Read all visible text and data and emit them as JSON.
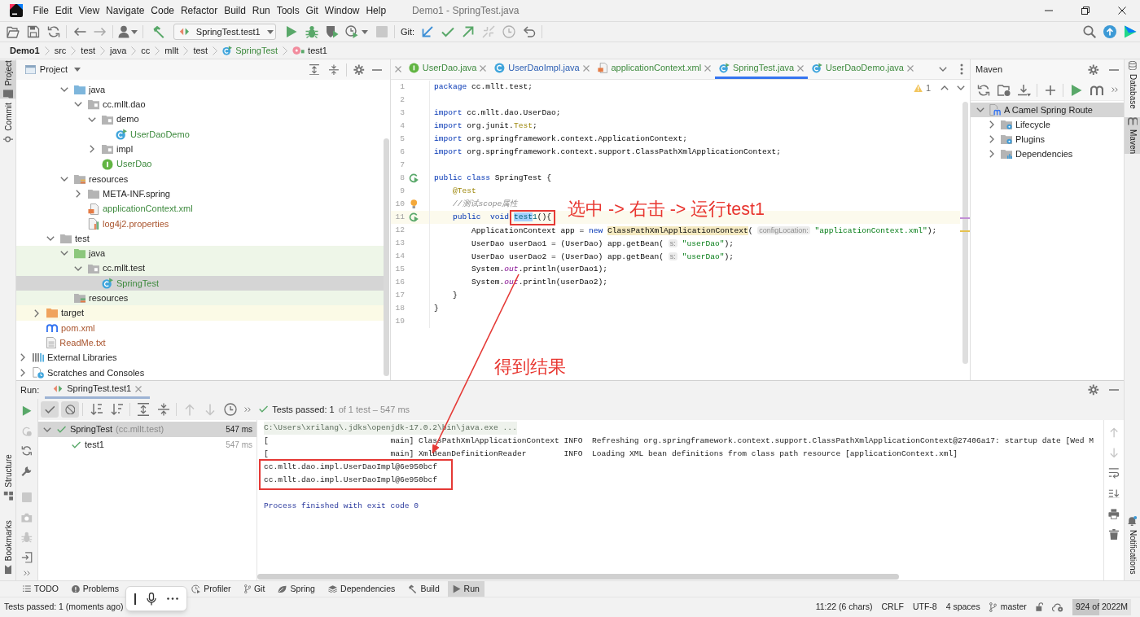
{
  "window": {
    "title": "Demo1 - SpringTest.java"
  },
  "menu": [
    "File",
    "Edit",
    "View",
    "Navigate",
    "Code",
    "Refactor",
    "Build",
    "Run",
    "Tools",
    "Git",
    "Window",
    "Help"
  ],
  "toolbar": {
    "run_configuration": "SpringTest.test1",
    "vcs_label": "Git:"
  },
  "breadcrumbs": [
    {
      "label": "Demo1",
      "kind": "project"
    },
    {
      "label": "src",
      "kind": "folder"
    },
    {
      "label": "test",
      "kind": "folder"
    },
    {
      "label": "java",
      "kind": "folder"
    },
    {
      "label": "cc",
      "kind": "folder"
    },
    {
      "label": "mllt",
      "kind": "folder"
    },
    {
      "label": "test",
      "kind": "folder"
    },
    {
      "label": "SpringTest",
      "kind": "class",
      "color": "#3e8a3e"
    },
    {
      "label": "test1",
      "kind": "method"
    }
  ],
  "left_tool_windows": [
    {
      "label": "Project",
      "kind": "project",
      "selected": true
    },
    {
      "label": "Commit",
      "kind": "commit",
      "selected": false
    }
  ],
  "left_tool_windows_bottom": [
    {
      "label": "Structure",
      "kind": "structure",
      "selected": false
    },
    {
      "label": "Bookmarks",
      "kind": "bookmarks",
      "selected": false
    }
  ],
  "right_tool_windows": [
    {
      "label": "Database",
      "kind": "database",
      "selected": false
    },
    {
      "label": "Maven",
      "kind": "maven",
      "selected": true
    }
  ],
  "right_tool_windows_bottom": [
    {
      "label": "Notifications",
      "kind": "notifications",
      "selected": false
    }
  ],
  "project": {
    "title": "Project",
    "tree": [
      {
        "children": [
          {
            "children": [
              {
                "children": [
                  {
                    "label": "java",
                    "kind": "source-root",
                    "expanded": true,
                    "selected": false,
                    "children": [
                      {
                        "label": "cc.mllt.dao",
                        "kind": "package",
                        "expanded": true,
                        "selected": false,
                        "children": [
                          {
                            "label": "demo",
                            "kind": "package",
                            "expanded": true,
                            "selected": false,
                            "children": [
                              {
                                "label": "UserDaoDemo",
                                "kind": "runnable-class",
                                "selected": false,
                                "color": "#3e8a3e"
                              }
                            ]
                          },
                          {
                            "label": "impl",
                            "kind": "package",
                            "expanded": false,
                            "selected": false
                          },
                          {
                            "label": "UserDao",
                            "kind": "interface",
                            "selected": false,
                            "color": "#3e8a3e"
                          }
                        ]
                      }
                    ]
                  },
                  {
                    "label": "resources",
                    "kind": "resources-root",
                    "expanded": true,
                    "selected": false,
                    "children": [
                      {
                        "label": "META-INF.spring",
                        "kind": "folder",
                        "expanded": false,
                        "selected": false
                      },
                      {
                        "label": "applicationContext.xml",
                        "kind": "xml-file",
                        "selected": false,
                        "color": "#3e8a3e"
                      },
                      {
                        "label": "log4j2.properties",
                        "kind": "properties-file",
                        "selected": false,
                        "color": "#a9542d"
                      }
                    ]
                  }
                ]
              },
              {
                "label": "test",
                "kind": "folder",
                "expanded": true,
                "selected": false,
                "children": [
                  {
                    "label": "java",
                    "kind": "test-root",
                    "expanded": true,
                    "selected": false,
                    "test_sources": true,
                    "children": [
                      {
                        "label": "cc.mllt.test",
                        "kind": "package",
                        "expanded": true,
                        "selected": false,
                        "test_sources": true,
                        "children": [
                          {
                            "label": "SpringTest",
                            "kind": "runnable-class",
                            "selected": true,
                            "color": "#3e8a3e"
                          }
                        ]
                      }
                    ]
                  },
                  {
                    "label": "resources",
                    "kind": "test-resources-root",
                    "selected": false,
                    "test_sources": true
                  }
                ]
              }
            ]
          },
          {
            "label": "target",
            "kind": "excluded-folder",
            "expanded": false,
            "selected": false,
            "excluded": true
          },
          {
            "label": "pom.xml",
            "kind": "maven-file",
            "selected": false,
            "color": "#a9542d"
          },
          {
            "label": "ReadMe.txt",
            "kind": "text-file",
            "selected": false,
            "color": "#a9542d"
          }
        ]
      },
      {
        "label": "External Libraries",
        "kind": "libraries",
        "expanded": false,
        "selected": false
      },
      {
        "label": "Scratches and Consoles",
        "kind": "scratches",
        "expanded": false,
        "selected": false
      }
    ]
  },
  "editor": {
    "tabs": [
      {
        "label": "UserDao.java",
        "kind": "interface",
        "selected": false,
        "color": "#3e8a3e"
      },
      {
        "label": "UserDaoImpl.java",
        "kind": "class",
        "selected": false,
        "color": "#2d5fb3"
      },
      {
        "label": "applicationContext.xml",
        "kind": "xml-file",
        "selected": false,
        "color": "#3e8a3e"
      },
      {
        "label": "SpringTest.java",
        "kind": "runnable-class",
        "selected": true,
        "color": "#3e8a3e"
      },
      {
        "label": "UserDaoDemo.java",
        "kind": "runnable-class",
        "selected": false,
        "color": "#3e8a3e"
      }
    ],
    "warning_count": "1",
    "lines": [
      {
        "number": "1",
        "current": false,
        "tokens": [
          {
            "text": "package",
            "kind": "keyword"
          },
          {
            "text": " cc.mllt.test;",
            "kind": "plain"
          }
        ]
      },
      {
        "number": "2",
        "current": false
      },
      {
        "number": "3",
        "current": false,
        "tokens": [
          {
            "text": "import",
            "kind": "keyword"
          },
          {
            "text": " cc.mllt.dao.UserDao;",
            "kind": "plain"
          }
        ]
      },
      {
        "number": "4",
        "current": false,
        "tokens": [
          {
            "text": "import",
            "kind": "keyword"
          },
          {
            "text": " org.junit.",
            "kind": "plain"
          },
          {
            "text": "Test",
            "kind": "annotation"
          },
          {
            "text": ";",
            "kind": "plain"
          }
        ]
      },
      {
        "number": "5",
        "current": false,
        "tokens": [
          {
            "text": "import",
            "kind": "keyword"
          },
          {
            "text": " org.springframework.context.ApplicationContext;",
            "kind": "plain"
          }
        ]
      },
      {
        "number": "6",
        "current": false,
        "tokens": [
          {
            "text": "import",
            "kind": "keyword"
          },
          {
            "text": " org.springframework.context.support.ClassPathXmlApplicationContext;",
            "kind": "plain"
          }
        ]
      },
      {
        "number": "7",
        "current": false
      },
      {
        "number": "8",
        "current": false,
        "run_marker": true,
        "tokens": [
          {
            "text": "public class",
            "kind": "keyword"
          },
          {
            "text": " SpringTest {",
            "kind": "plain"
          }
        ]
      },
      {
        "number": "9",
        "current": false,
        "tokens": [
          {
            "text": "    @Test",
            "kind": "annotation"
          }
        ]
      },
      {
        "number": "10",
        "current": false,
        "intention_bulb": true,
        "tokens": [
          {
            "text": "    //测试scope属性",
            "kind": "comment"
          }
        ]
      },
      {
        "number": "11",
        "current": true,
        "run_marker": true,
        "tokens": [
          {
            "text": "    public  ",
            "kind": "keyword"
          },
          {
            "text": "void ",
            "kind": "keyword"
          },
          {
            "text": "test",
            "kind": "selection"
          },
          {
            "text": "1",
            "kind": "method"
          },
          {
            "text": "(){",
            "kind": "plain"
          }
        ]
      },
      {
        "number": "12",
        "current": false,
        "tokens": [
          {
            "text": "        ApplicationContext app = ",
            "kind": "plain"
          },
          {
            "text": "new ",
            "kind": "keyword"
          },
          {
            "text": "ClassPathXmlApplicationContext",
            "kind": "warning"
          },
          {
            "text": "( ",
            "kind": "plain"
          },
          {
            "text": "configLocation:",
            "kind": "hint"
          },
          {
            "text": " \"applicationContext.xml\"",
            "kind": "string"
          },
          {
            "text": ");",
            "kind": "plain"
          }
        ]
      },
      {
        "number": "13",
        "current": false,
        "tokens": [
          {
            "text": "        UserDao userDao1 = (UserDao) app.getBean( ",
            "kind": "plain"
          },
          {
            "text": "s:",
            "kind": "hint"
          },
          {
            "text": " \"userDao\"",
            "kind": "string"
          },
          {
            "text": ");",
            "kind": "plain"
          }
        ]
      },
      {
        "number": "14",
        "current": false,
        "tokens": [
          {
            "text": "        UserDao userDao2 = (UserDao) app.getBean( ",
            "kind": "plain"
          },
          {
            "text": "s:",
            "kind": "hint"
          },
          {
            "text": " \"userDao\"",
            "kind": "string"
          },
          {
            "text": ");",
            "kind": "plain"
          }
        ]
      },
      {
        "number": "15",
        "current": false,
        "tokens": [
          {
            "text": "        System.",
            "kind": "plain"
          },
          {
            "text": "out",
            "kind": "static"
          },
          {
            "text": ".println(userDao1);",
            "kind": "plain"
          }
        ]
      },
      {
        "number": "16",
        "current": false,
        "tokens": [
          {
            "text": "        System.",
            "kind": "plain"
          },
          {
            "text": "out",
            "kind": "static"
          },
          {
            "text": ".println(userDao2);",
            "kind": "plain"
          }
        ]
      },
      {
        "number": "17",
        "current": false,
        "tokens": [
          {
            "text": "    }",
            "kind": "plain"
          }
        ]
      },
      {
        "number": "18",
        "current": false,
        "tokens": [
          {
            "text": "}",
            "kind": "plain"
          }
        ]
      },
      {
        "number": "19",
        "current": false
      }
    ]
  },
  "maven": {
    "title": "Maven",
    "tree": [
      {
        "label": "A Camel Spring Route",
        "kind": "project",
        "expanded": true,
        "selected": true,
        "children": [
          {
            "label": "Lifecycle",
            "kind": "lifecycle",
            "expanded": false,
            "selected": false
          },
          {
            "label": "Plugins",
            "kind": "plugins",
            "expanded": false,
            "selected": false
          },
          {
            "label": "Dependencies",
            "kind": "dependencies",
            "expanded": false,
            "selected": false
          }
        ]
      }
    ]
  },
  "run": {
    "title": "Run:",
    "tabs": [
      {
        "label": "SpringTest.test1",
        "selected": true
      }
    ],
    "toggles": [
      {
        "kind": "show-passed",
        "on": true
      },
      {
        "kind": "show-ignored",
        "on": true
      }
    ],
    "summary": {
      "success": true,
      "label": "Tests passed: 1",
      "detail": "of 1 test – 547 ms"
    },
    "tests": [
      {
        "label": "SpringTest",
        "detail": "(cc.mllt.test)",
        "duration": "547 ms",
        "success": true,
        "expanded": true,
        "selected": true,
        "children": [
          {
            "label": "test1",
            "duration": "547 ms",
            "success": true,
            "selected": false
          }
        ]
      }
    ],
    "console": [
      {
        "kind": "command",
        "text": "C:\\Users\\xrilang\\.jdks\\openjdk-17.0.2\\bin\\java.exe ..."
      },
      {
        "kind": "log",
        "text": "[                          main] ClassPathXmlApplicationContext INFO  Refreshing org.springframework.context.support.ClassPathXmlApplicationContext@27406a17: startup date [Wed M"
      },
      {
        "kind": "log",
        "text": "[                          main] XmlBeanDefinitionReader        INFO  Loading XML bean definitions from class path resource [applicationContext.xml]"
      },
      {
        "kind": "output",
        "text": "cc.mllt.dao.impl.UserDaoImpl@6e950bcf"
      },
      {
        "kind": "output",
        "text": "cc.mllt.dao.impl.UserDaoImpl@6e950bcf"
      },
      {
        "kind": "exit",
        "text": "Process finished with exit code 0"
      }
    ]
  },
  "bottom_tool_windows": [
    {
      "label": "TODO",
      "kind": "todo",
      "selected": false
    },
    {
      "label": "Problems",
      "kind": "problems",
      "selected": false
    },
    {
      "label": "Profiler",
      "kind": "profiler",
      "selected": false
    },
    {
      "label": "Git",
      "kind": "git",
      "selected": false
    },
    {
      "label": "Spring",
      "kind": "spring",
      "selected": false
    },
    {
      "label": "Dependencies",
      "kind": "dependencies",
      "selected": false
    },
    {
      "label": "Build",
      "kind": "build",
      "selected": false
    },
    {
      "label": "Run",
      "kind": "run",
      "selected": true
    }
  ],
  "status_bar": {
    "message": "Tests passed: 1 (moments ago)",
    "position": "11:22 (6 chars)",
    "line_separator": "CRLF",
    "encoding": "UTF-8",
    "indent": "4 spaces",
    "branch": "master",
    "memory": {
      "label": "924 of 2022M",
      "level": 0.46
    }
  },
  "annotations": {
    "instruction": "选中 -> 右击 -> 运行test1",
    "result": "得到结果"
  }
}
